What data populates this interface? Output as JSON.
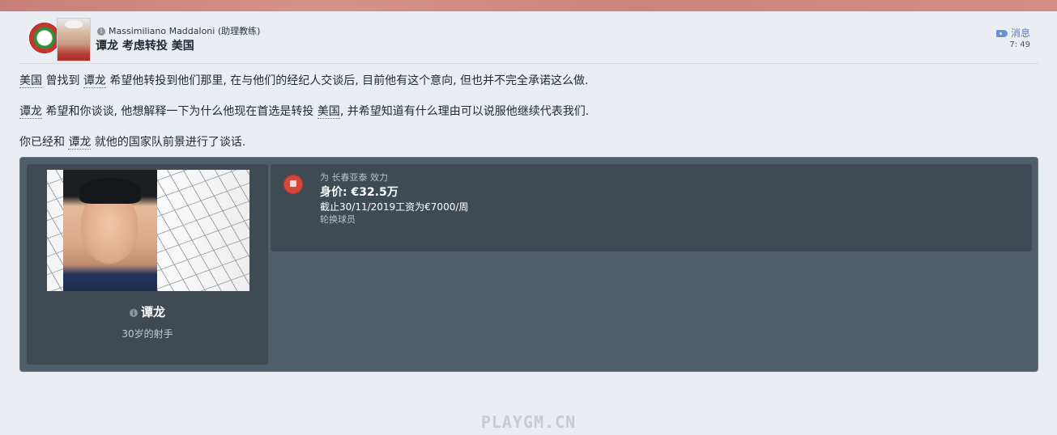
{
  "header": {
    "sender": "Massimiliano Maddaloni (助理教练)",
    "subject": "谭龙 考虑转投 美国",
    "tag_label": "消息",
    "time": "7: 49",
    "tag_color": "#5b7fc4"
  },
  "body": {
    "p1": {
      "a": "美国",
      "b": " 曾找到 ",
      "c": "谭龙",
      "d": " 希望他转投到他们那里, 在与他们的经纪人交谈后, 目前他有这个意向, 但也并不完全承诺这么做."
    },
    "p2": {
      "a": "谭龙",
      "b": " 希望和你谈谈, 他想解释一下为什么他现在首选是转投 ",
      "c": "美国",
      "d": ", 并希望知道有什么理由可以说服他继续代表我们."
    },
    "p3": {
      "a": "你已经和 ",
      "b": "谭龙",
      "c": " 就他的国家队前景进行了谈话."
    }
  },
  "player": {
    "name": "谭龙",
    "description": "30岁的射手",
    "plays_for": "为 长春亚泰 效力",
    "value": "身价: €32.5万",
    "wage": "截止30/11/2019工资为€7000/周",
    "role": "轮换球员",
    "club_color": "#d6473a"
  },
  "watermark": "PLAYGM.CN"
}
